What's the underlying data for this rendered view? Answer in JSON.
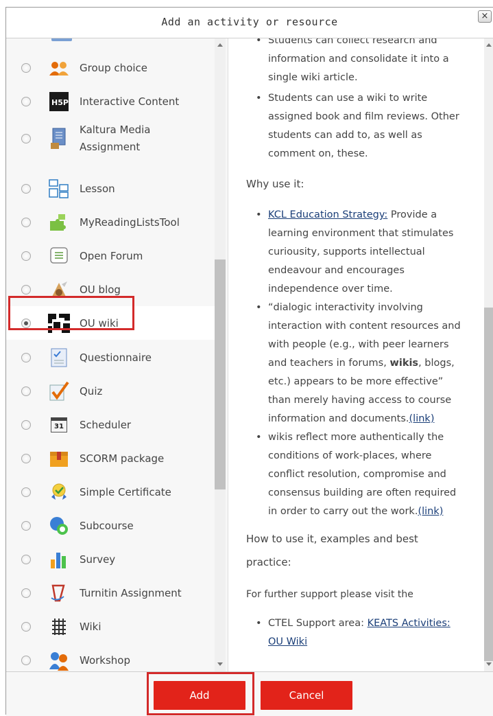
{
  "dialog": {
    "title": "Add an activity or resource",
    "close_label": "×"
  },
  "options": [
    {
      "label": "Group choice",
      "icon": "group-choice-icon"
    },
    {
      "label": "Interactive Content",
      "icon": "h5p-icon"
    },
    {
      "label": "Kaltura Media",
      "label2": "Assignment",
      "icon": "kaltura-icon"
    },
    {
      "label": "Lesson",
      "icon": "lesson-icon"
    },
    {
      "label": "MyReadingListsTool",
      "icon": "puzzle-icon"
    },
    {
      "label": "Open Forum",
      "icon": "forum-icon"
    },
    {
      "label": "OU blog",
      "icon": "blog-icon"
    },
    {
      "label": "OU wiki",
      "icon": "ou-wiki-icon",
      "selected": true
    },
    {
      "label": "Questionnaire",
      "icon": "questionnaire-icon"
    },
    {
      "label": "Quiz",
      "icon": "quiz-icon"
    },
    {
      "label": "Scheduler",
      "icon": "calendar-icon",
      "icon_text": "31"
    },
    {
      "label": "SCORM package",
      "icon": "scorm-icon"
    },
    {
      "label": "Simple Certificate",
      "icon": "certificate-icon"
    },
    {
      "label": "Subcourse",
      "icon": "subcourse-icon"
    },
    {
      "label": "Survey",
      "icon": "survey-icon"
    },
    {
      "label": "Turnitin Assignment",
      "icon": "turnitin-icon"
    },
    {
      "label": "Wiki",
      "icon": "wiki-icon"
    },
    {
      "label": "Workshop",
      "icon": "workshop-icon"
    }
  ],
  "description": {
    "top_bullets": [
      [
        "Students can collect research and",
        "information and consolidate it into a",
        "single wiki article."
      ],
      [
        "Students can use a wiki to write",
        "assigned book and film reviews. Other",
        "students can add to, as well as",
        "comment on, these."
      ]
    ],
    "why_heading": "Why use it:",
    "why_bullets": {
      "b1_link": "KCL Education Strategy:",
      "b1_line1": " Provide a",
      "b1_rest": [
        "learning environment that stimulates",
        "curiousity, supports intellectual",
        "endeavour and encourages",
        "independence over time."
      ],
      "b2_lines": [
        "“dialogic interactivity involving",
        "interaction with content resources and",
        "with people (e.g., with peer learners"
      ],
      "b2_l4a": "and teachers in forums, ",
      "b2_l4b": "wikis",
      "b2_l4c": ", blogs,",
      "b2_rest": [
        "etc.) appears to be more effective”",
        "than merely having access to course"
      ],
      "b2_last": "information and documents.",
      "b2_link": "(link)",
      "b3_lines": [
        "wikis reflect more authentically the",
        "conditions of work-places, where",
        "conflict resolution, compromise and",
        "consensus building are often required"
      ],
      "b3_last": "in order to carry out the work.",
      "b3_link": "(link)"
    },
    "how_heading_1": "How to use it, examples and best",
    "how_heading_2": "practice:",
    "support_text": "For further support please visit the",
    "support_prefix": "CTEL Support area: ",
    "support_link_1": "KEATS Activities:",
    "support_link_2": "OU Wiki"
  },
  "footer": {
    "add_label": "Add",
    "cancel_label": "Cancel"
  },
  "colors": {
    "accent": "#e2231a",
    "highlight": "#d32a2a",
    "link": "#1a3e78"
  }
}
